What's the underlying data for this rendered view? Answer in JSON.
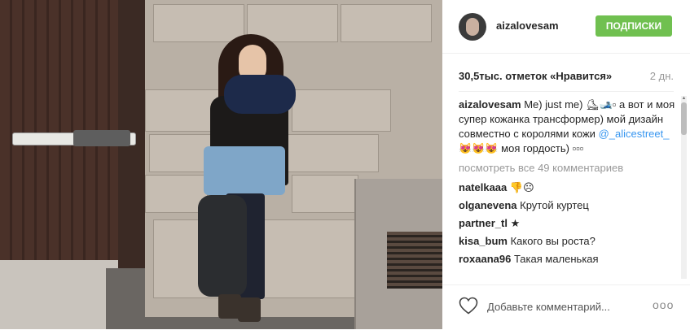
{
  "post": {
    "username": "aizalovesam",
    "follow_label": "ПОДПИСКИ",
    "likes": "30,5тыс. отметок «Нравится»",
    "time": "2 дн."
  },
  "caption": {
    "username": "aizalovesam",
    "text_1": " Me) just me) ⛸🎿▫ а вот и моя супер кожанка трансформер) мой дизайн совместно с королями кожи ",
    "mention": "@_alicestreet_",
    "text_2": " 😻😻😻 моя гордость) ▫▫▫"
  },
  "view_all": "посмотреть все 49 комментариев",
  "comments": [
    {
      "user": "natelkaaa",
      "text": " 👎☹"
    },
    {
      "user": "olganevena",
      "text": " Крутой куртец"
    },
    {
      "user": "partner_tl",
      "text": " ★"
    },
    {
      "user": "kisa_bum",
      "text": " Какого вы роста?"
    },
    {
      "user": "roxaana96",
      "text": " Такая маленькая"
    }
  ],
  "footer": {
    "placeholder": "Добавьте комментарий...",
    "more": "ooo"
  }
}
